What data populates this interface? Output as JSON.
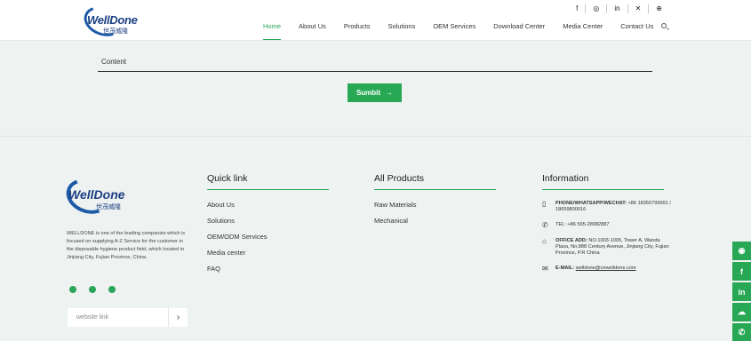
{
  "brand": {
    "name": "WellDone",
    "cn_name": "世茂威隆"
  },
  "header": {
    "social": [
      "f",
      "◎",
      "in",
      "✕",
      "⊕"
    ],
    "nav": [
      "Home",
      "About Us",
      "Products",
      "Solutions",
      "OEM Services",
      "Download Center",
      "Media Center",
      "Contact Us"
    ],
    "active": "Home"
  },
  "form": {
    "content_placeholder": "Content",
    "submit_label": "Sumbit",
    "submit_arrow": "→"
  },
  "footer": {
    "about": "WELLDONE is one of the leading companies which is focused on supplying A-Z Service for the customer in the disposable hygiene product field, which located in Jinjiang City, Fujian Province, China.",
    "website_placeholder": "website link",
    "website_go": "›",
    "quick_link": {
      "title": "Quick link",
      "items": [
        "About Us",
        "Solutions",
        "OEM/ODM Services",
        "Media center",
        "FAQ"
      ]
    },
    "all_products": {
      "title": "All Products",
      "items": [
        "Raw Materials",
        "Mechanical"
      ]
    },
    "information": {
      "title": "Information",
      "phone_label": "PHONE/WHATSAPP/WECHAT:",
      "phone_value": "+86 18350799991 / 18659800016",
      "tel": "TEL: +86 595-28082887",
      "address_label": "OFFICE ADD:",
      "address_value": "NO.1003-1005, Tower A, Wanda Plaza, No.888 Century Avenue, Jinjiang City, Fujian Province, P.R China",
      "email_label": "E-MAIL:",
      "email_value": "welldone@cnwelldone.com"
    }
  },
  "sidebar": [
    "◉",
    "f",
    "in",
    "☁",
    "✆"
  ],
  "colors": {
    "accent": "#28a855",
    "brand_blue": "#1b3f82",
    "background": "#eef2f1"
  }
}
